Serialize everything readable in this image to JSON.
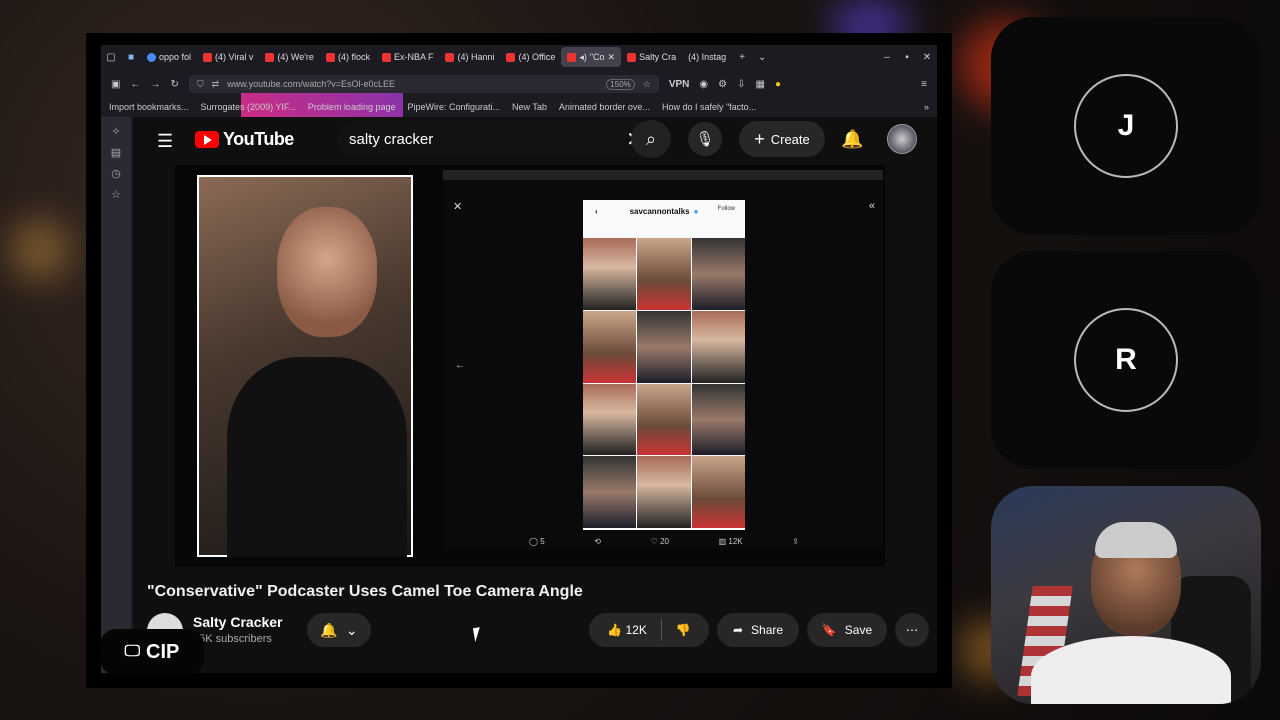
{
  "tabs": [
    {
      "label": "oppo fol",
      "icon": "google-icon"
    },
    {
      "label": "(4) Viral v",
      "icon": "youtube-icon"
    },
    {
      "label": "(4) We're",
      "icon": "youtube-icon"
    },
    {
      "label": "(4) flock",
      "icon": "youtube-icon"
    },
    {
      "label": "Ex-NBA F",
      "icon": "youtube-icon"
    },
    {
      "label": "(4) Hanni",
      "icon": "youtube-icon"
    },
    {
      "label": "(4) Office",
      "icon": "youtube-icon"
    },
    {
      "label": "\"Co",
      "icon": "youtube-icon",
      "active": true
    },
    {
      "label": "Salty Cra",
      "icon": "youtube-icon"
    },
    {
      "label": "(4) Instag",
      "icon": "instagram-icon"
    }
  ],
  "urlbar": {
    "url": "www.youtube.com/watch?v=EsOl-e0cLEE",
    "zoom": "150%",
    "vpn": "VPN"
  },
  "bookmarks": [
    "Import bookmarks...",
    "Surrogates (2009) YIF...",
    "Problem loading page",
    "PipeWire: Configurati...",
    "New Tab",
    "Animated border ove...",
    "How do I safely \"facto..."
  ],
  "youtube": {
    "logo": "YouTube",
    "search_query": "salty cracker",
    "create_label": "Create",
    "video": {
      "title": "\"Conservative\" Podcaster Uses Camel Toe Camera Angle",
      "channel_name": "Salty Cracker",
      "subscribers": "35K subscribers",
      "likes": "12K",
      "share_label": "Share",
      "save_label": "Save"
    },
    "embedded": {
      "profile_name": "savcannontalks",
      "follow": "Follow",
      "stats": {
        "replies": "5",
        "likes": "20",
        "views": "12K"
      }
    }
  },
  "overlay": {
    "cip_label": "CIP"
  },
  "participants": [
    {
      "initial": "J"
    },
    {
      "initial": "R"
    }
  ]
}
